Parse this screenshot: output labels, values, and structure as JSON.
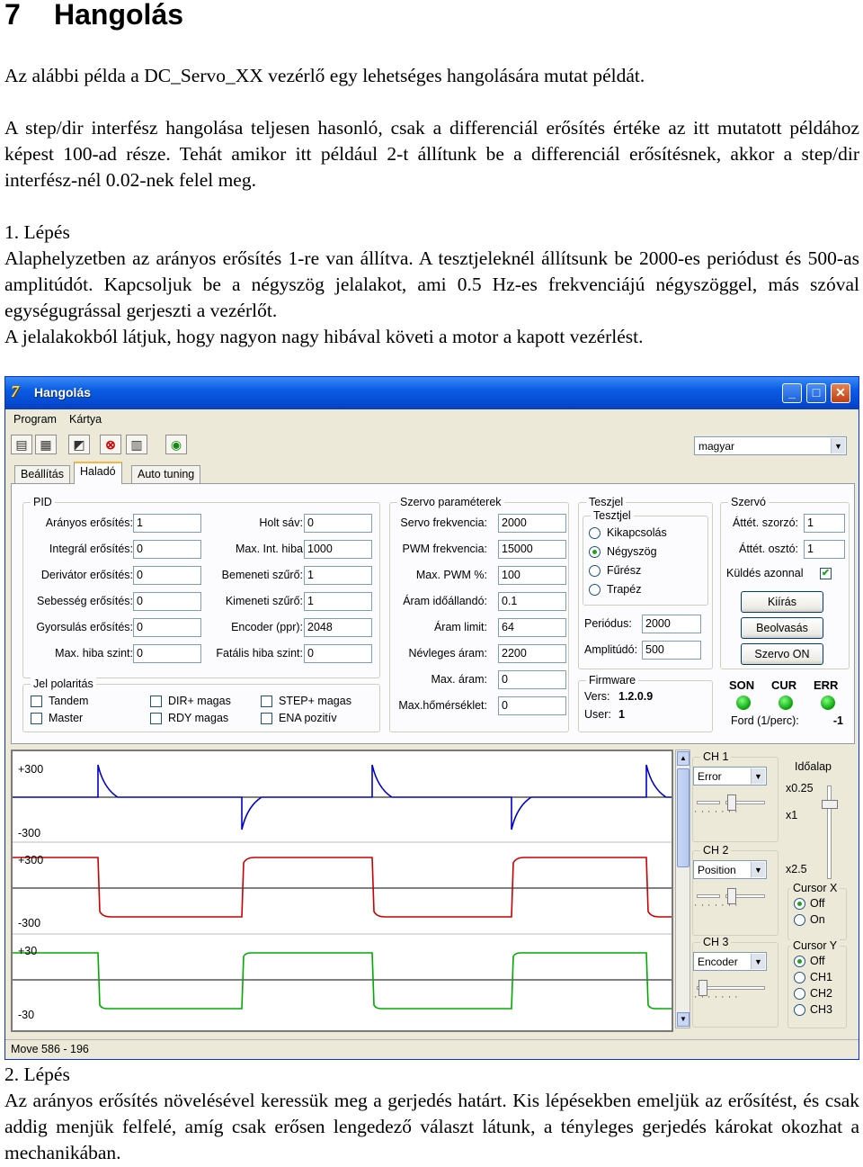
{
  "doc": {
    "section_number": "7",
    "section_title": "Hangolás",
    "para1": "Az alábbi példa a DC_Servo_XX vezérlő egy lehetséges hangolására mutat példát.",
    "para2": "A step/dir interfész hangolása teljesen hasonló, csak a differenciál erősítés értéke az itt mutatott példához képest 100-ad része. Tehát amikor itt például 2-t állítunk be a differenciál erősítésnek, akkor a step/dir interfész-nél 0.02-nek felel meg.",
    "step1_heading": "1. Lépés",
    "step1_text": "Alaphelyzetben az arányos erősítés 1-re van állítva. A tesztjeleknél állítsunk be 2000-es periódust és 500-as amplitúdót. Kapcsoljuk be a négyszög jelalakot, ami 0.5 Hz-es frekvenciájú négyszöggel, más szóval egységugrással gerjeszti a vezérlőt.",
    "step1_text2": "A jelalakokból látjuk, hogy nagyon nagy hibával követi a motor a kapott vezérlést.",
    "step2_heading": "2. Lépés",
    "step2_text": "Az arányos erősítés növelésével keressük meg a gerjedés határt. Kis lépésekben emeljük az erősítést, és csak addig menjük felfelé, amíg csak erősen lengedező választ látunk, a tényleges gerjedés károkat okozhat a mechanikában."
  },
  "app": {
    "icon_glyph": "7",
    "title": "Hangolás",
    "title_buttons": [
      "_",
      "□",
      "✕"
    ],
    "menu": [
      "Program",
      "Kártya"
    ],
    "toolbar_glyphs": [
      "▤",
      "▦",
      "◩",
      "⊗",
      "▥",
      "◉"
    ],
    "language": "magyar",
    "tabs": [
      "Beállítás",
      "Haladó",
      "Auto tuning"
    ],
    "pid": {
      "title": "PID",
      "left_labels": [
        "Arányos erősítés:",
        "Integrál erősítés:",
        "Derivátor erősítés:",
        "Sebesség erősítés:",
        "Gyorsulás erősítés:",
        "Max. hiba szint:"
      ],
      "left_values": [
        "1",
        "0",
        "0",
        "0",
        "0",
        "0"
      ],
      "right_labels": [
        "Holt sáv:",
        "Max. Int. hiba",
        "Bemeneti szűrő:",
        "Kimeneti szűrő:",
        "Encoder (ppr):",
        "Fatális hiba szint:"
      ],
      "right_values": [
        "0",
        "1000",
        "1",
        "1",
        "2048",
        "0"
      ]
    },
    "polarity": {
      "title": "Jel polaritás",
      "items": [
        "Tandem",
        "Master",
        "DIR+ magas",
        "RDY magas",
        "STEP+ magas",
        "ENA pozitív"
      ]
    },
    "servo": {
      "title": "Szervo paraméterek",
      "labels": [
        "Servo frekvencia:",
        "PWM frekvencia:",
        "Max. PWM %:",
        "Áram időállandó:",
        "Áram limit:",
        "Névleges áram:",
        "Max. áram:",
        "Max.hőmérséklet:"
      ],
      "values": [
        "2000",
        "15000",
        "100",
        "0.1",
        "64",
        "2200",
        "0",
        "0"
      ]
    },
    "test": {
      "title": "Teszjel",
      "inner_title": "Tesztjel",
      "options": [
        "Kikapcsolás",
        "Négyszög",
        "Fűrész",
        "Trapéz"
      ],
      "selected": 1,
      "period_label": "Periódus:",
      "period": "2000",
      "amp_label": "Amplitúdó:",
      "amp": "500"
    },
    "firmware": {
      "title": "Firmware",
      "ver_label": "Vers:",
      "ver": "1.2.0.9",
      "user_label": "User:",
      "user": "1"
    },
    "szervo": {
      "title": "Szervó",
      "labels": [
        "Áttét. szorzó:",
        "Áttét. osztó:"
      ],
      "values": [
        "1",
        "1"
      ],
      "send_label": "Küldés azonnal",
      "send_checked": "✔",
      "buttons": [
        "Kiírás",
        "Beolvasás",
        "Szervo ON"
      ],
      "leds": [
        "SON",
        "CUR",
        "ERR"
      ],
      "led_color": "#06a006",
      "ford_label": "Ford (1/perc):",
      "ford": "-1"
    },
    "scope": {
      "ch1": {
        "top": "+300",
        "bottom": "-300"
      },
      "ch2": {
        "top": "+300",
        "bottom": "-300"
      },
      "ch3": {
        "top": "+30",
        "bottom": "-30"
      },
      "colors": {
        "ch1": "#0000cc",
        "ch2": "#cc0000",
        "ch3": "#00aa00",
        "mid": "#000000"
      }
    },
    "side": {
      "ch1_label": "CH 1",
      "ch1_select": "Error",
      "ch2_label": "CH 2",
      "ch2_select": "Position",
      "ch3_label": "CH 3",
      "ch3_select": "Encoder",
      "timescale_label": "Időalap",
      "time_marks": [
        "x0.25",
        "x1",
        "x2.5"
      ],
      "cursor_x_label": "Cursor X",
      "cursor_x_options": [
        "Off",
        "On"
      ],
      "cursor_y_label": "Cursor Y",
      "cursor_y_options": [
        "Off",
        "CH1",
        "CH2",
        "CH3"
      ]
    },
    "status": "Move 586 - 196"
  }
}
